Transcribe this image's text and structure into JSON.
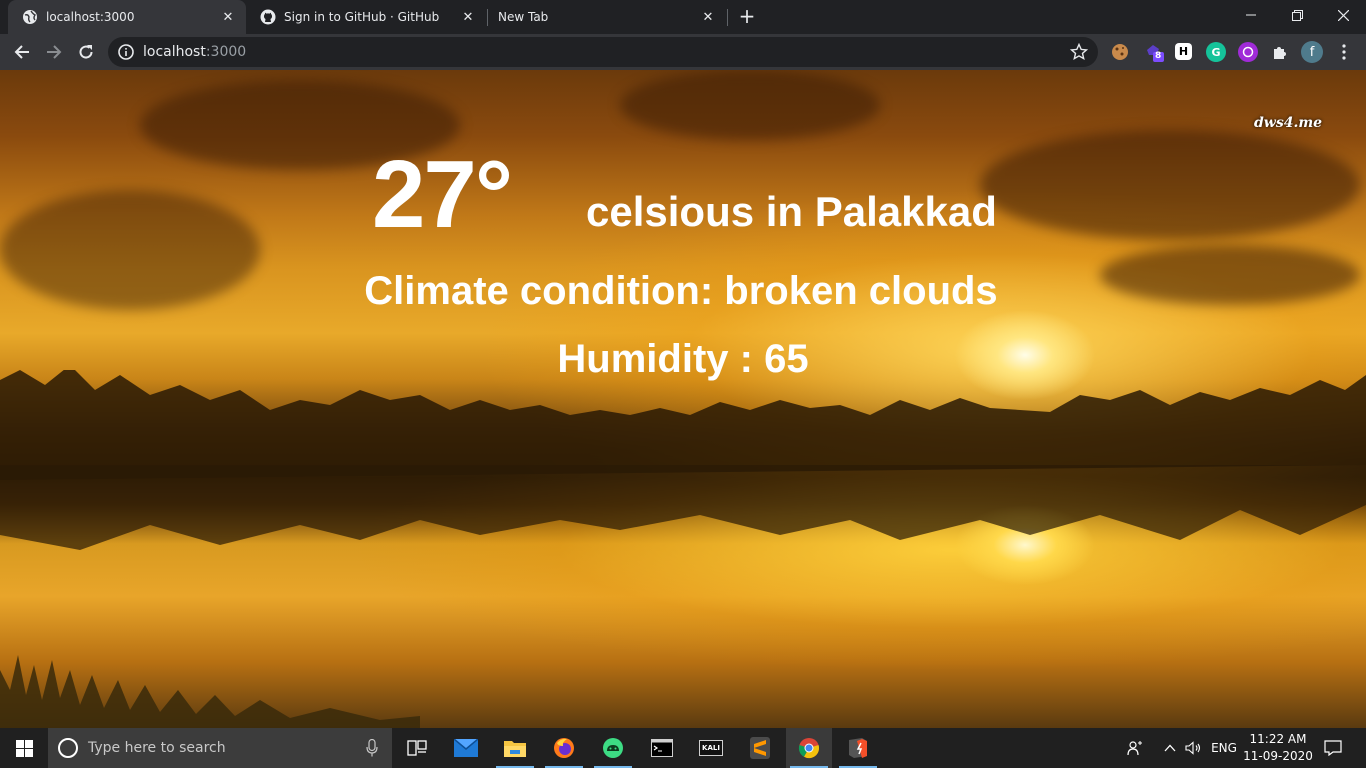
{
  "browser": {
    "tabs": [
      {
        "title": "localhost:3000",
        "favicon": "globe-icon",
        "active": true
      },
      {
        "title": "Sign in to GitHub · GitHub",
        "favicon": "github-icon",
        "active": false
      },
      {
        "title": "New Tab",
        "favicon": "none",
        "active": false
      }
    ],
    "address": {
      "host": "localhost",
      "port": ":3000"
    },
    "extensions": [
      "cookie-icon",
      "extension-badge-icon",
      "h-icon",
      "grammarly-icon",
      "vpn-icon",
      "puzzle-icon"
    ],
    "extension_badge": "8",
    "profile_initial": "f"
  },
  "page": {
    "watermark": "dws4.me",
    "temperature": "27°",
    "unit_city": "celsious in Palakkad",
    "climate": "Climate condition: broken clouds",
    "humidity": "Humidity : 65"
  },
  "taskbar": {
    "search_placeholder": "Type here to search",
    "apps": [
      "task-view-icon",
      "mail-icon",
      "file-explorer-icon",
      "firefox-icon",
      "android-studio-icon",
      "terminal-icon",
      "kali-icon",
      "sublime-text-icon",
      "chrome-icon",
      "git-bash-icon"
    ],
    "kali_label": "KALI",
    "language": "ENG",
    "time": "11:22 AM",
    "date": "11-09-2020"
  },
  "colors": {
    "chrome_dark": "#202124",
    "chrome_toolbar": "#35363a",
    "taskbar": "#202020",
    "accent": "#76b9ed"
  }
}
